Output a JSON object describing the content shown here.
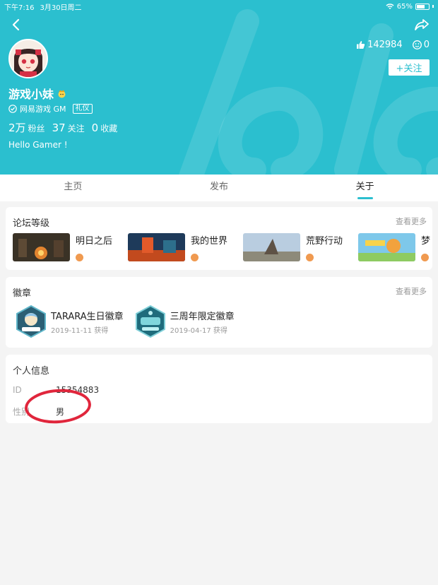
{
  "status_bar": {
    "time": "下午7:16",
    "date": "3月30日周二",
    "battery": "65%"
  },
  "header": {
    "likes": "142984",
    "smiles": "0",
    "follow_label": "+关注",
    "username": "游戏小妹",
    "verify_text": "网易游戏 GM",
    "tag": "礼仪",
    "fans_num": "2万",
    "fans_label": "粉丝",
    "following_num": "37",
    "following_label": "关注",
    "fav_num": "0",
    "fav_label": "收藏",
    "bio": "Hello Gamer !"
  },
  "tabs": [
    {
      "label": "主页"
    },
    {
      "label": "发布"
    },
    {
      "label": "关于"
    }
  ],
  "forum": {
    "title": "论坛等级",
    "more": "查看更多",
    "items": [
      {
        "name": "明日之后"
      },
      {
        "name": "我的世界"
      },
      {
        "name": "荒野行动"
      },
      {
        "name": "梦"
      }
    ]
  },
  "badges": {
    "title": "徽章",
    "more": "查看更多",
    "items": [
      {
        "name": "TARARA生日徽章",
        "date": "2019-11-11 获得"
      },
      {
        "name": "三周年限定徽章",
        "date": "2019-04-17 获得"
      }
    ]
  },
  "personal": {
    "title": "个人信息",
    "id_label": "ID",
    "id_value": "15354883",
    "gender_label": "性别",
    "gender_value": "男"
  },
  "colors": {
    "accent": "#2bbfcf",
    "highlight": "#e0263c"
  }
}
